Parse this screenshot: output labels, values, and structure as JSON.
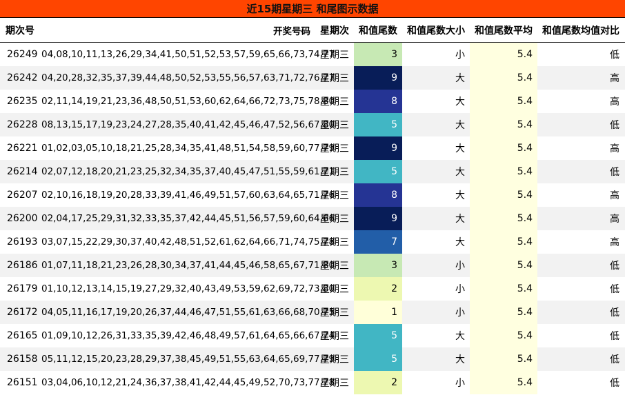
{
  "title": "近15期星期三 和尾图示数据",
  "headers": [
    "期次号",
    "开奖号码",
    "星期次",
    "和值尾数",
    "和值尾数大小",
    "和值尾数平均",
    "和值尾数均值对比"
  ],
  "colors": {
    "title_bg": "#ff4500",
    "avg_bg": "#ffffe0",
    "tail_scale": {
      "1": "#ffffd9",
      "2": "#edf8b1",
      "3": "#c7e9b4",
      "5": "#41b6c4",
      "7": "#225ea8",
      "8": "#253494",
      "9": "#081d58"
    }
  },
  "rows": [
    {
      "issue": "26249",
      "numbers": "04,08,10,11,13,26,29,34,41,50,51,52,53,57,59,65,66,73,74,77",
      "weekday": "星期三",
      "tail": "3",
      "size": "小",
      "avg": "5.4",
      "cmp": "低"
    },
    {
      "issue": "26242",
      "numbers": "04,20,28,32,35,37,39,44,48,50,52,53,55,56,57,63,71,72,76,77",
      "weekday": "星期三",
      "tail": "9",
      "size": "大",
      "avg": "5.4",
      "cmp": "高"
    },
    {
      "issue": "26235",
      "numbers": "02,11,14,19,21,23,36,48,50,51,53,60,62,64,66,72,73,75,78,80",
      "weekday": "星期三",
      "tail": "8",
      "size": "大",
      "avg": "5.4",
      "cmp": "高"
    },
    {
      "issue": "26228",
      "numbers": "08,13,15,17,19,23,24,27,28,35,40,41,42,45,46,47,52,56,67,80",
      "weekday": "星期三",
      "tail": "5",
      "size": "大",
      "avg": "5.4",
      "cmp": "低"
    },
    {
      "issue": "26221",
      "numbers": "01,02,03,05,10,18,21,25,28,34,35,41,48,51,54,58,59,60,77,79",
      "weekday": "星期三",
      "tail": "9",
      "size": "大",
      "avg": "5.4",
      "cmp": "高"
    },
    {
      "issue": "26214",
      "numbers": "02,07,12,18,20,21,23,25,32,34,35,37,40,45,47,51,55,59,61,71",
      "weekday": "星期三",
      "tail": "5",
      "size": "大",
      "avg": "5.4",
      "cmp": "低"
    },
    {
      "issue": "26207",
      "numbers": "02,10,16,18,19,20,28,33,39,41,46,49,51,57,60,63,64,65,71,76",
      "weekday": "星期三",
      "tail": "8",
      "size": "大",
      "avg": "5.4",
      "cmp": "高"
    },
    {
      "issue": "26200",
      "numbers": "02,04,17,25,29,31,32,33,35,37,42,44,45,51,56,57,59,60,64,66",
      "weekday": "星期三",
      "tail": "9",
      "size": "大",
      "avg": "5.4",
      "cmp": "高"
    },
    {
      "issue": "26193",
      "numbers": "03,07,15,22,29,30,37,40,42,48,51,52,61,62,64,66,71,74,75,78",
      "weekday": "星期三",
      "tail": "7",
      "size": "大",
      "avg": "5.4",
      "cmp": "高"
    },
    {
      "issue": "26186",
      "numbers": "01,07,11,18,21,23,26,28,30,34,37,41,44,45,46,58,65,67,71,80",
      "weekday": "星期三",
      "tail": "3",
      "size": "小",
      "avg": "5.4",
      "cmp": "低"
    },
    {
      "issue": "26179",
      "numbers": "01,10,12,13,14,15,19,27,29,32,40,43,49,53,59,62,69,72,73,80",
      "weekday": "星期三",
      "tail": "2",
      "size": "小",
      "avg": "5.4",
      "cmp": "低"
    },
    {
      "issue": "26172",
      "numbers": "04,05,11,16,17,19,20,26,37,44,46,47,51,55,61,63,66,68,70,75",
      "weekday": "星期三",
      "tail": "1",
      "size": "小",
      "avg": "5.4",
      "cmp": "低"
    },
    {
      "issue": "26165",
      "numbers": "01,09,10,12,26,31,33,35,39,42,46,48,49,57,61,64,65,66,67,74",
      "weekday": "星期三",
      "tail": "5",
      "size": "大",
      "avg": "5.4",
      "cmp": "低"
    },
    {
      "issue": "26158",
      "numbers": "05,11,12,15,20,23,28,29,37,38,45,49,51,55,63,64,65,69,77,79",
      "weekday": "星期三",
      "tail": "5",
      "size": "大",
      "avg": "5.4",
      "cmp": "低"
    },
    {
      "issue": "26151",
      "numbers": "03,04,06,10,12,21,24,36,37,38,41,42,44,45,49,52,70,73,77,78",
      "weekday": "星期三",
      "tail": "2",
      "size": "小",
      "avg": "5.4",
      "cmp": "低"
    }
  ]
}
